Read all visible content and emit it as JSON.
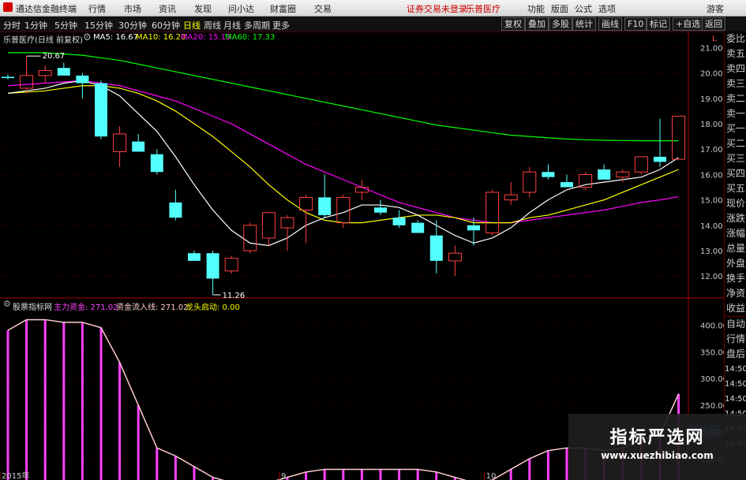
{
  "topbar": {
    "app_title": "通达信金融终端",
    "menu": [
      "行情",
      "市场",
      "资讯",
      "发现",
      "问小达",
      "财富圈",
      "交易"
    ],
    "notice": "证券交易未登录",
    "stock": "乐普医疗",
    "right_menu": [
      "功能",
      "版面",
      "公式",
      "选项"
    ],
    "guest": "游客"
  },
  "periods": [
    "分时",
    "1分钟",
    "5分钟",
    "15分钟",
    "30分钟",
    "60分钟",
    "日线",
    "周线",
    "月线",
    "多周期",
    "更多"
  ],
  "active_period": "日线",
  "toolbar_buttons": [
    "复权",
    "叠加",
    "多股",
    "统计",
    "画线",
    "F10",
    "标记",
    "+自选",
    "返回"
  ],
  "main_legend": {
    "stock_label": "乐普医疗(日线 前复权)",
    "ma5": "MA5: 16.67",
    "ma10": "MA10: 16.20",
    "ma20": "MA20: 15.13",
    "ma60": "MA60: 17.33",
    "high_label": "20.67",
    "low_label": "11.26"
  },
  "indicator_legend": {
    "name": "股票指标网",
    "main_fund": "主力资金: 271.02",
    "inflow": "资金流入线: 271.02",
    "dragon": "龙头启动: 0.00",
    "current_value": "200.32"
  },
  "side_panel": [
    "委比",
    "卖五",
    "卖四",
    "卖三",
    "卖二",
    "卖一",
    "买一",
    "买二",
    "买三",
    "买四",
    "买五",
    "现价",
    "涨跌",
    "涨幅",
    "总量",
    "外盘",
    "换手",
    "净资",
    "收益",
    "自动",
    "行情",
    "盘后",
    "14:50",
    "14:50",
    "14:50",
    "14:50",
    "14:50",
    "14:50"
  ],
  "corner_mark": "L",
  "x_axis_labels": [
    {
      "label": "2015年",
      "index": 0
    },
    {
      "label": "9",
      "index": 15
    },
    {
      "label": "10",
      "index": 26
    }
  ],
  "watermark": {
    "title": "指标严选网",
    "url": "www.xuezhibiao.com"
  },
  "colors": {
    "up": "#ff4040",
    "down": "#54ffff",
    "ma5": "#ffffff",
    "ma10": "#ffff00",
    "ma20": "#ff00ff",
    "ma60": "#00ff00",
    "indicator_bar": "#ff40ff",
    "indicator_line": "#ffcccc"
  },
  "chart_data": [
    {
      "type": "candlestick",
      "title": "乐普医疗(日线 前复权)",
      "ylim": [
        11.2,
        21.2
      ],
      "yticks": [
        12.0,
        13.0,
        14.0,
        15.0,
        16.0,
        17.0,
        18.0,
        19.0,
        20.0,
        21.0
      ],
      "ohlc": [
        [
          19.85,
          19.95,
          19.75,
          19.8
        ],
        [
          19.4,
          20.67,
          19.2,
          19.9
        ],
        [
          19.9,
          20.3,
          19.6,
          20.1
        ],
        [
          20.2,
          20.4,
          19.9,
          19.9
        ],
        [
          19.9,
          20.0,
          19.0,
          19.6
        ],
        [
          19.6,
          19.7,
          17.4,
          17.5
        ],
        [
          16.9,
          17.9,
          16.3,
          17.6
        ],
        [
          17.3,
          17.6,
          17.0,
          16.9
        ],
        [
          16.8,
          17.0,
          16.0,
          16.1
        ],
        [
          14.9,
          15.4,
          14.2,
          14.3
        ],
        [
          12.9,
          13.0,
          12.6,
          12.6
        ],
        [
          12.9,
          13.0,
          11.26,
          11.9
        ],
        [
          12.2,
          12.8,
          12.1,
          12.7
        ],
        [
          13.0,
          14.1,
          12.9,
          14.0
        ],
        [
          13.5,
          14.5,
          13.2,
          14.5
        ],
        [
          13.9,
          14.4,
          13.0,
          14.3
        ],
        [
          14.6,
          15.2,
          13.3,
          15.1
        ],
        [
          15.1,
          16.0,
          14.3,
          14.4
        ],
        [
          14.1,
          15.2,
          13.9,
          15.1
        ],
        [
          15.3,
          15.8,
          15.0,
          15.5
        ],
        [
          14.7,
          15.0,
          14.4,
          14.5
        ],
        [
          14.3,
          14.6,
          13.9,
          14.0
        ],
        [
          14.1,
          14.2,
          13.7,
          13.7
        ],
        [
          13.6,
          14.2,
          12.1,
          12.6
        ],
        [
          12.6,
          13.2,
          12.0,
          12.9
        ],
        [
          14.0,
          14.3,
          13.2,
          13.8
        ],
        [
          13.7,
          15.4,
          13.6,
          15.3
        ],
        [
          15.0,
          15.7,
          14.8,
          15.2
        ],
        [
          15.3,
          16.3,
          15.1,
          16.1
        ],
        [
          16.1,
          16.4,
          15.8,
          15.9
        ],
        [
          15.7,
          16.0,
          15.5,
          15.5
        ],
        [
          15.5,
          16.1,
          15.4,
          16.0
        ],
        [
          16.2,
          16.4,
          15.8,
          15.8
        ],
        [
          15.9,
          16.2,
          15.7,
          16.1
        ],
        [
          16.1,
          16.7,
          16.0,
          16.7
        ],
        [
          16.7,
          18.2,
          16.3,
          16.5
        ],
        [
          16.6,
          18.3,
          16.6,
          18.3
        ]
      ],
      "ma5": [
        19.2,
        19.3,
        19.4,
        19.6,
        19.7,
        19.5,
        19.1,
        18.4,
        17.7,
        16.7,
        15.6,
        14.6,
        13.8,
        13.3,
        13.2,
        13.5,
        14.0,
        14.3,
        14.5,
        14.8,
        14.8,
        14.7,
        14.4,
        14.0,
        13.6,
        13.3,
        13.5,
        13.9,
        14.5,
        15.0,
        15.4,
        15.6,
        15.7,
        15.8,
        15.9,
        16.2,
        16.67
      ],
      "ma10": [
        19.2,
        19.25,
        19.3,
        19.4,
        19.5,
        19.5,
        19.4,
        19.2,
        18.9,
        18.5,
        18.0,
        17.5,
        16.9,
        16.3,
        15.6,
        15.0,
        14.5,
        14.2,
        14.1,
        14.1,
        14.2,
        14.3,
        14.4,
        14.4,
        14.3,
        14.1,
        14.1,
        14.1,
        14.3,
        14.4,
        14.6,
        14.8,
        15.0,
        15.3,
        15.6,
        15.9,
        16.2
      ],
      "ma20": [
        19.5,
        19.55,
        19.6,
        19.65,
        19.7,
        19.6,
        19.5,
        19.3,
        19.1,
        18.9,
        18.6,
        18.3,
        18.0,
        17.6,
        17.2,
        16.8,
        16.4,
        16.1,
        15.8,
        15.5,
        15.2,
        14.9,
        14.7,
        14.5,
        14.3,
        14.2,
        14.1,
        14.1,
        14.2,
        14.3,
        14.4,
        14.5,
        14.6,
        14.75,
        14.9,
        15.0,
        15.13
      ],
      "ma60": [
        20.8,
        20.8,
        20.8,
        20.75,
        20.7,
        20.6,
        20.5,
        20.35,
        20.2,
        20.05,
        19.9,
        19.75,
        19.6,
        19.45,
        19.3,
        19.15,
        19.0,
        18.85,
        18.7,
        18.55,
        18.4,
        18.25,
        18.1,
        17.95,
        17.85,
        17.75,
        17.65,
        17.55,
        17.5,
        17.45,
        17.4,
        17.37,
        17.35,
        17.34,
        17.33,
        17.33,
        17.33
      ]
    },
    {
      "type": "bar",
      "title": "股票指标网",
      "ylim": [
        110,
        430
      ],
      "yticks": [
        150,
        200,
        250,
        300,
        350,
        400
      ],
      "series": [
        {
          "name": "主力资金",
          "values": [
            390,
            410,
            410,
            405,
            405,
            395,
            330,
            250,
            170,
            155,
            135,
            115,
            105,
            100,
            105,
            115,
            125,
            130,
            130,
            130,
            130,
            130,
            130,
            125,
            115,
            105,
            110,
            130,
            150,
            165,
            170,
            170,
            165,
            170,
            185,
            195,
            271.02
          ]
        },
        {
          "name": "资金流入线",
          "values": [
            390,
            410,
            410,
            405,
            405,
            395,
            330,
            250,
            170,
            155,
            135,
            115,
            105,
            100,
            105,
            115,
            125,
            130,
            130,
            130,
            130,
            130,
            130,
            125,
            115,
            105,
            110,
            130,
            150,
            165,
            170,
            170,
            165,
            170,
            185,
            195,
            271.02
          ]
        }
      ]
    }
  ]
}
